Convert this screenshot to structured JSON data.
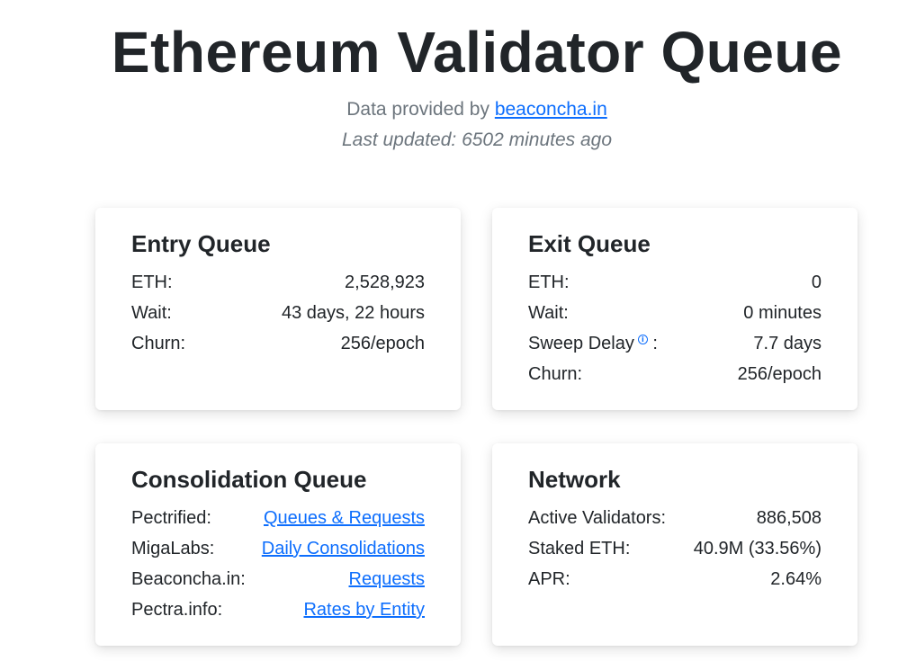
{
  "header": {
    "title": "Ethereum Validator Queue",
    "provided_prefix": "Data provided by ",
    "provided_link": "beaconcha.in",
    "last_updated": "Last updated: 6502 minutes ago"
  },
  "entry_queue": {
    "title": "Entry Queue",
    "rows": [
      {
        "label": "ETH:",
        "value": "2,528,923"
      },
      {
        "label": "Wait:",
        "value": "43 days, 22 hours"
      },
      {
        "label": "Churn:",
        "value": "256/epoch"
      }
    ]
  },
  "exit_queue": {
    "title": "Exit Queue",
    "rows": [
      {
        "label": "ETH:",
        "value": "0"
      },
      {
        "label": "Wait:",
        "value": "0 minutes"
      },
      {
        "label": "Sweep Delay",
        "label_suffix": " :",
        "info_icon": "i",
        "value": "7.7 days"
      },
      {
        "label": "Churn:",
        "value": "256/epoch"
      }
    ]
  },
  "consolidation_queue": {
    "title": "Consolidation Queue",
    "rows": [
      {
        "label": "Pectrified:",
        "link": "Queues & Requests"
      },
      {
        "label": "MigaLabs:",
        "link": "Daily Consolidations"
      },
      {
        "label": "Beaconcha.in:",
        "link": "Requests"
      },
      {
        "label": "Pectra.info:",
        "link": "Rates by Entity"
      }
    ]
  },
  "network": {
    "title": "Network",
    "rows": [
      {
        "label": "Active Validators:",
        "value": "886,508"
      },
      {
        "label": "Staked ETH:",
        "value": "40.9M (33.56%)"
      },
      {
        "label": "APR:",
        "value": "2.64%"
      }
    ]
  },
  "colors": {
    "link": "#0d6efd",
    "text": "#212529",
    "muted": "#6c757d"
  }
}
